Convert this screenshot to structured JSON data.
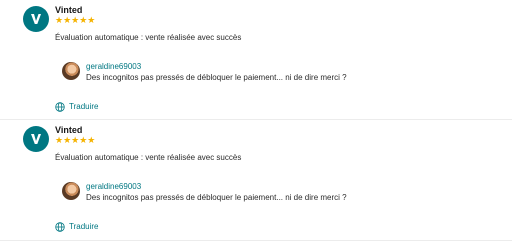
{
  "reviews": [
    {
      "author": "Vinted",
      "rating": 5,
      "stars": "★★★★★",
      "message": "Évaluation automatique : vente réalisée avec succès",
      "reply": {
        "author": "geraldine69003",
        "text": "Des incognitos pas pressés de débloquer le paiement... ni de dire merci ?"
      },
      "translate_label": "Traduire"
    },
    {
      "author": "Vinted",
      "rating": 5,
      "stars": "★★★★★",
      "message": "Évaluation automatique : vente réalisée avec succès",
      "reply": {
        "author": "geraldine69003",
        "text": "Des incognitos pas pressés de débloquer le paiement... ni de dire merci ?"
      },
      "translate_label": "Traduire"
    }
  ],
  "colors": {
    "brand": "#007782",
    "star": "#f5b301"
  },
  "icons": {
    "brand_avatar": "vinted-logo-icon",
    "translate": "globe-icon"
  }
}
